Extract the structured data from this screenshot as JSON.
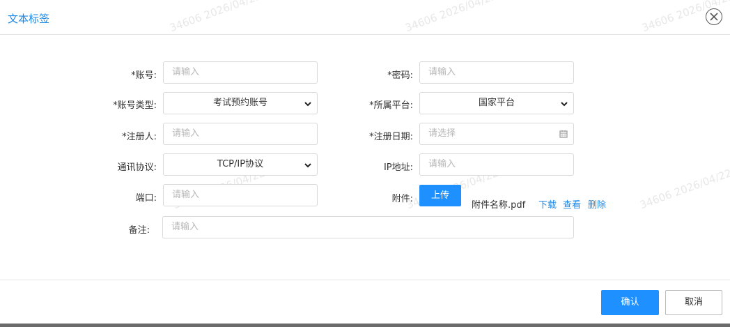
{
  "dialog": {
    "title": "文本标签",
    "confirm_label": "确认",
    "cancel_label": "取消"
  },
  "form": {
    "account": {
      "label": "*账号:",
      "placeholder": "请输入"
    },
    "password": {
      "label": "*密码:",
      "placeholder": "请输入"
    },
    "account_type": {
      "label": "*账号类型:",
      "value": "考试预约账号"
    },
    "platform": {
      "label": "*所属平台:",
      "value": "国家平台"
    },
    "registrant": {
      "label": "*注册人:",
      "placeholder": "请输入"
    },
    "register_date": {
      "label": "*注册日期:",
      "placeholder": "请选择"
    },
    "protocol": {
      "label": "通讯协议:",
      "value": "TCP/IP协议"
    },
    "ip": {
      "label": "IP地址:",
      "placeholder": "请输入"
    },
    "port": {
      "label": "端口:",
      "placeholder": "请输入"
    },
    "attachment": {
      "label": "附件:",
      "upload_label": "上传",
      "file_name": "附件名称.pdf",
      "download": "下载",
      "view": "查看",
      "delete": "删除"
    },
    "remark": {
      "label": "备注:",
      "placeholder": "请输入"
    }
  },
  "watermark": "34606 2026/04/22",
  "colors": {
    "accent": "#1e90ff",
    "link": "#1e88e5"
  }
}
